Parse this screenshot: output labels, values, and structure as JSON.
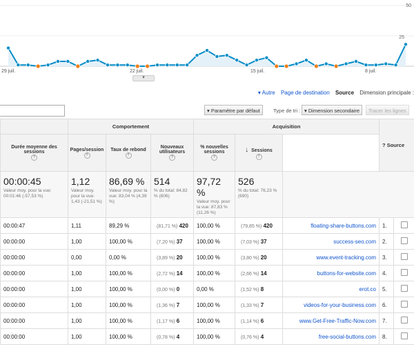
{
  "chart": {
    "y_labels": [
      "50",
      "25"
    ],
    "x_labels": [
      "29 juil.",
      "22 juil.",
      "15 juil.",
      "8 juil."
    ],
    "values": [
      18,
      1,
      2,
      1,
      1,
      4,
      2,
      0,
      2,
      0,
      5,
      2,
      0,
      0,
      7,
      5,
      1,
      5,
      9,
      8,
      13,
      9,
      1,
      1,
      1,
      1,
      0,
      0,
      1,
      1,
      1,
      5,
      4,
      0,
      4,
      4,
      1,
      0,
      1,
      1,
      15
    ],
    "accent_line": "#058dc7",
    "accent_fill": "#e5f1f9",
    "point_color": "#ed7e17"
  },
  "dimension_bar": {
    "label": "Dimension principale :",
    "items": [
      "Source",
      "Page de destination",
      "Autre"
    ]
  },
  "toolbar": {
    "plot_rows": "Tracer les lignes",
    "secondary_dimension": "Dimension secondaire",
    "sort_type_label": "Type de tri :",
    "sort_type_value": "Paramètre par défaut"
  },
  "table": {
    "group_headers": {
      "acquisition": "Acquisition",
      "behavior": "Comportement"
    },
    "columns": {
      "source": "Source",
      "sessions": "Sessions",
      "pct_new_sessions": "% nouvelles sessions",
      "new_users": "Nouveaux utilisateurs",
      "bounce_rate": "Taux de rebond",
      "pages_per_session": "Pages/session",
      "avg_duration": "Durée moyenne des sessions"
    },
    "totals": {
      "sessions": "526",
      "sessions_sub": "% du total: 76,23 % (690)",
      "pct_new": "97,72 %",
      "pct_new_sub": "Valeur moy. pour la vue: 87,83 % (11,26 %)",
      "new_users": "514",
      "new_users_sub": "% du total: 84,82 % (606)",
      "bounce": "86,69 %",
      "bounce_sub": "Valeur moy. pour la vue: 83,04 % (4,39 %)",
      "pages": "1,12",
      "pages_sub": "Valeur moy. pour la vue: 1,43 (-21,51 %)",
      "duration": "00:00:45",
      "duration_sub": "Valeur moy. pour la vue: 00:01:46 (-57,53 %)"
    },
    "rows": [
      {
        "idx": "1.",
        "source": "floating-share-buttons.com",
        "sessions": "420",
        "sessions_pct": "(79,85 %)",
        "pct_new": "100,00 %",
        "new_users": "420",
        "new_users_pct": "(81,71 %)",
        "bounce": "89,29 %",
        "pages": "1,11",
        "duration": "00:00:47"
      },
      {
        "idx": "2.",
        "source": "success-seo.com",
        "sessions": "37",
        "sessions_pct": "(7,03 %)",
        "pct_new": "100,00 %",
        "new_users": "37",
        "new_users_pct": "(7,20 %)",
        "bounce": "100,00 %",
        "pages": "1,00",
        "duration": "00:00:00"
      },
      {
        "idx": "3.",
        "source": "www.event-tracking.com",
        "sessions": "20",
        "sessions_pct": "(3,80 %)",
        "pct_new": "100,00 %",
        "new_users": "20",
        "new_users_pct": "(3,89 %)",
        "bounce": "0,00 %",
        "pages": "0,00",
        "duration": "00:00:00"
      },
      {
        "idx": "4.",
        "source": "buttons-for-website.com",
        "sessions": "14",
        "sessions_pct": "(2,66 %)",
        "pct_new": "100,00 %",
        "new_users": "14",
        "new_users_pct": "(2,72 %)",
        "bounce": "100,00 %",
        "pages": "1,00",
        "duration": "00:00:00"
      },
      {
        "idx": "5.",
        "source": "erot.co",
        "sessions": "8",
        "sessions_pct": "(1,52 %)",
        "pct_new": "0,00 %",
        "new_users": "0",
        "new_users_pct": "(0,00 %)",
        "bounce": "100,00 %",
        "pages": "1,00",
        "duration": "00:00:00"
      },
      {
        "idx": "6.",
        "source": "videos-for-your-business.com",
        "sessions": "7",
        "sessions_pct": "(1,33 %)",
        "pct_new": "100,00 %",
        "new_users": "7",
        "new_users_pct": "(1,36 %)",
        "bounce": "100,00 %",
        "pages": "1,00",
        "duration": "00:00:00"
      },
      {
        "idx": "7.",
        "source": "www.Get-Free-Traffic-Now.com",
        "sessions": "6",
        "sessions_pct": "(1,14 %)",
        "pct_new": "100,00 %",
        "new_users": "6",
        "new_users_pct": "(1,17 %)",
        "bounce": "100,00 %",
        "pages": "1,00",
        "duration": "00:00:00"
      },
      {
        "idx": "8.",
        "source": "free-social-buttons.com",
        "sessions": "4",
        "sessions_pct": "(0,76 %)",
        "pct_new": "100,00 %",
        "new_users": "4",
        "new_users_pct": "(0,78 %)",
        "bounce": "100,00 %",
        "pages": "1,00",
        "duration": "00:00:00"
      }
    ]
  }
}
